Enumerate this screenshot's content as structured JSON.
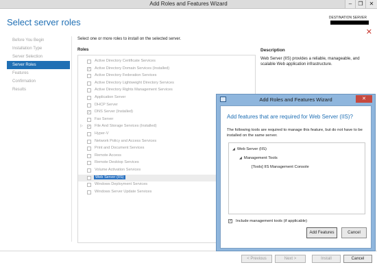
{
  "window": {
    "title": "Add Roles and Features Wizard",
    "min": "–",
    "max": "❐",
    "close": "✕"
  },
  "header": {
    "page_title": "Select server roles",
    "destination_label": "DESTINATION SERVER",
    "close_icon": "✕"
  },
  "nav": {
    "items": [
      {
        "label": "Before You Begin"
      },
      {
        "label": "Installation Type"
      },
      {
        "label": "Server Selection"
      },
      {
        "label": "Server Roles"
      },
      {
        "label": "Features"
      },
      {
        "label": "Confirmation"
      },
      {
        "label": "Results"
      }
    ],
    "active_index": 3
  },
  "main": {
    "instruction": "Select one or more roles to install on the selected server.",
    "roles_title": "Roles",
    "roles": [
      {
        "label": "Active Directory Certificate Services",
        "checked": false,
        "expandable": false
      },
      {
        "label": "Active Directory Domain Services (Installed)",
        "checked": true,
        "expandable": false
      },
      {
        "label": "Active Directory Federation Services",
        "checked": false,
        "expandable": false
      },
      {
        "label": "Active Directory Lightweight Directory Services",
        "checked": false,
        "expandable": false
      },
      {
        "label": "Active Directory Rights Management Services",
        "checked": false,
        "expandable": false
      },
      {
        "label": "Application Server",
        "checked": false,
        "expandable": false
      },
      {
        "label": "DHCP Server",
        "checked": false,
        "expandable": false
      },
      {
        "label": "DNS Server (Installed)",
        "checked": true,
        "expandable": false
      },
      {
        "label": "Fax Server",
        "checked": false,
        "expandable": false
      },
      {
        "label": "File And Storage Services (Installed)",
        "checked": true,
        "expandable": true
      },
      {
        "label": "Hyper-V",
        "checked": false,
        "expandable": false
      },
      {
        "label": "Network Policy and Access Services",
        "checked": false,
        "expandable": false
      },
      {
        "label": "Print and Document Services",
        "checked": false,
        "expandable": false
      },
      {
        "label": "Remote Access",
        "checked": false,
        "expandable": false
      },
      {
        "label": "Remote Desktop Services",
        "checked": false,
        "expandable": false
      },
      {
        "label": "Volume Activation Services",
        "checked": false,
        "expandable": false
      },
      {
        "label": "Web Server (IIS)",
        "checked": false,
        "expandable": false,
        "selected": true
      },
      {
        "label": "Windows Deployment Services",
        "checked": false,
        "expandable": false
      },
      {
        "label": "Windows Server Update Services",
        "checked": false,
        "expandable": false
      }
    ],
    "description_title": "Description",
    "description_text": "Web Server (IIS) provides a reliable, manageable, and scalable Web application infrastructure."
  },
  "footer": {
    "previous": "< Previous",
    "next": "Next >",
    "install": "Install",
    "cancel": "Cancel"
  },
  "dialog": {
    "title": "Add Roles and Features Wizard",
    "close": "✕",
    "heading": "Add features that are required for Web Server (IIS)?",
    "text": "The following tools are required to manage this feature, but do not have to be installed on the same server.",
    "tree": [
      {
        "label": "Web Server (IIS)",
        "level": 0,
        "expanded": true
      },
      {
        "label": "Management Tools",
        "level": 1,
        "expanded": true
      },
      {
        "label": "[Tools] IIS Management Console",
        "level": 2,
        "expanded": false
      }
    ],
    "include_tools_label": "Include management tools (if applicable)",
    "include_tools_checked": true,
    "add_button": "Add Features",
    "cancel_button": "Cancel"
  },
  "colors": {
    "accent": "#1f6fb4",
    "dialog_frame": "#8fb6dd",
    "close_red": "#c8372f"
  }
}
